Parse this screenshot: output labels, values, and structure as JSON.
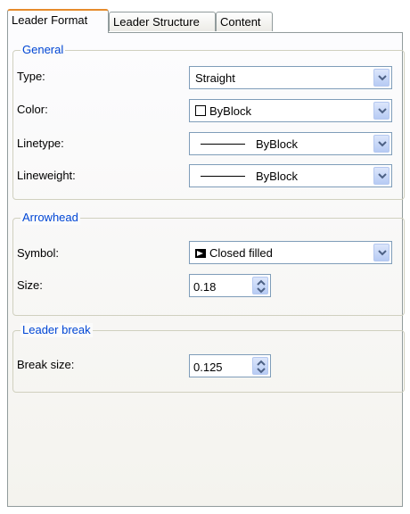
{
  "tabs": [
    {
      "label": "Leader Format",
      "active": true
    },
    {
      "label": "Leader Structure",
      "active": false
    },
    {
      "label": "Content",
      "active": false
    }
  ],
  "general": {
    "title": "General",
    "type_label": "Type:",
    "type_value": "Straight",
    "color_label": "Color:",
    "color_value": "ByBlock",
    "linetype_label": "Linetype:",
    "linetype_value": "ByBlock",
    "lineweight_label": "Lineweight:",
    "lineweight_value": "ByBlock"
  },
  "arrowhead": {
    "title": "Arrowhead",
    "symbol_label": "Symbol:",
    "symbol_value": "Closed filled",
    "size_label": "Size:",
    "size_value": "0.18"
  },
  "leader_break": {
    "title": "Leader break",
    "break_size_label": "Break size:",
    "break_size_value": "0.125"
  },
  "colors": {
    "group_title": "#0046d5",
    "active_tab_accent": "#e68b2c",
    "field_border": "#7f9db9"
  }
}
